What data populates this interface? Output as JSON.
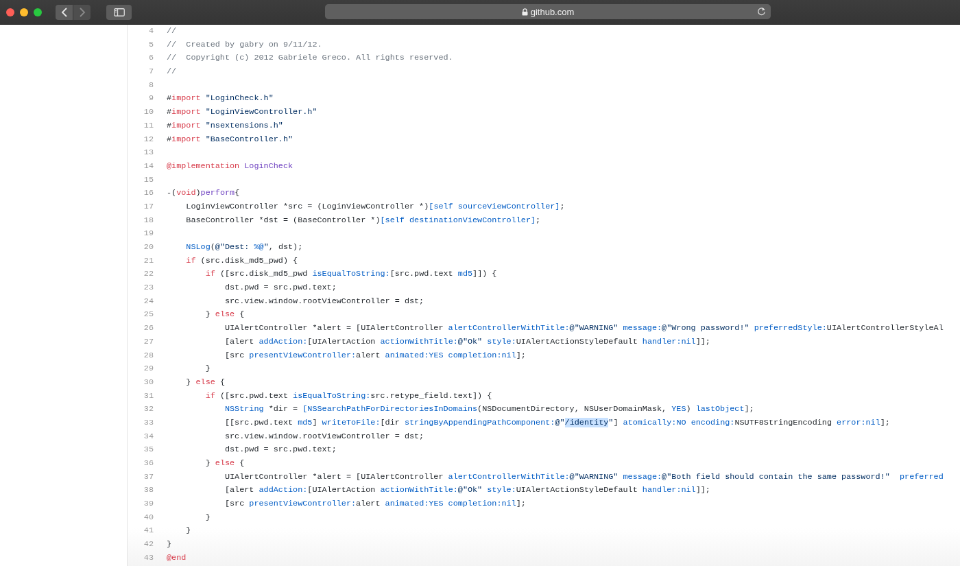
{
  "browser": {
    "window_controls": [
      {
        "color": "#fe5f57"
      },
      {
        "color": "#febc2e"
      },
      {
        "color": "#28c840"
      }
    ],
    "nav_buttons": [
      {
        "kind": "back",
        "disabled": false
      },
      {
        "kind": "forward",
        "disabled": true
      }
    ],
    "address": "github.com"
  },
  "code": {
    "lines": [
      {
        "number": "4",
        "tokens": [
          {
            "kind": "comment",
            "text": "//"
          }
        ]
      },
      {
        "number": "5",
        "tokens": [
          {
            "kind": "comment",
            "text": "//  Created by gabry on 9/11/12."
          }
        ]
      },
      {
        "number": "6",
        "tokens": [
          {
            "kind": "comment",
            "text": "//  Copyright (c) 2012 Gabriele Greco. All rights reserved."
          }
        ]
      },
      {
        "number": "7",
        "tokens": [
          {
            "kind": "comment",
            "text": "//"
          }
        ]
      },
      {
        "number": "8"
      },
      {
        "number": "9",
        "tokens": [
          {
            "kind": "plain",
            "text": "#"
          },
          {
            "kind": "keyword",
            "text": "import"
          },
          {
            "kind": "string",
            "text": " \"LoginCheck.h\""
          }
        ]
      },
      {
        "number": "10",
        "tokens": [
          {
            "kind": "plain",
            "text": "#"
          },
          {
            "kind": "keyword",
            "text": "import"
          },
          {
            "kind": "string",
            "text": " \"LoginViewController.h\""
          }
        ]
      },
      {
        "number": "11",
        "tokens": [
          {
            "kind": "plain",
            "text": "#"
          },
          {
            "kind": "keyword",
            "text": "import"
          },
          {
            "kind": "string",
            "text": " \"nsextensions.h\""
          }
        ]
      },
      {
        "number": "12",
        "tokens": [
          {
            "kind": "plain",
            "text": "#"
          },
          {
            "kind": "keyword",
            "text": "import"
          },
          {
            "kind": "string",
            "text": " \"BaseController.h\""
          }
        ]
      },
      {
        "number": "13"
      },
      {
        "number": "14",
        "tokens": [
          {
            "kind": "keyword",
            "text": "@implementation "
          },
          {
            "kind": "entity",
            "text": "LoginCheck"
          }
        ]
      },
      {
        "number": "15"
      },
      {
        "number": "16",
        "tokens": [
          {
            "kind": "plain",
            "text": "-("
          },
          {
            "kind": "keyword",
            "text": "void"
          },
          {
            "kind": "plain",
            "text": ")"
          },
          {
            "kind": "entity",
            "text": "perform"
          },
          {
            "kind": "plain",
            "text": "{"
          }
        ]
      },
      {
        "number": "17",
        "tokens": [
          {
            "kind": "plain",
            "text": "    LoginViewController *src = (LoginViewController *)"
          },
          {
            "kind": "call",
            "text": "[self sourceViewController]"
          },
          {
            "kind": "plain",
            "text": ";"
          }
        ]
      },
      {
        "number": "18",
        "tokens": [
          {
            "kind": "plain",
            "text": "    BaseController *dst = (BaseController *)"
          },
          {
            "kind": "call",
            "text": "[self destinationViewController]"
          },
          {
            "kind": "plain",
            "text": ";"
          }
        ]
      },
      {
        "number": "19"
      },
      {
        "number": "20",
        "tokens": [
          {
            "kind": "call",
            "text": "    NSLog"
          },
          {
            "kind": "plain",
            "text": "("
          },
          {
            "kind": "string",
            "text": "@\"Dest: "
          },
          {
            "kind": "call",
            "text": "%@"
          },
          {
            "kind": "string",
            "text": "\""
          },
          {
            "kind": "plain",
            "text": ", dst);"
          }
        ]
      },
      {
        "number": "21",
        "tokens": [
          {
            "kind": "keyword",
            "text": "    if"
          },
          {
            "kind": "plain",
            "text": " (src.disk_md5_pwd) {"
          }
        ]
      },
      {
        "number": "22",
        "tokens": [
          {
            "kind": "keyword",
            "text": "        if"
          },
          {
            "kind": "plain",
            "text": " ([src.disk_md5_pwd "
          },
          {
            "kind": "call",
            "text": "isEqualToString:"
          },
          {
            "kind": "plain",
            "text": "[src.pwd.text "
          },
          {
            "kind": "call",
            "text": "md5"
          },
          {
            "kind": "plain",
            "text": "]]) {"
          }
        ]
      },
      {
        "number": "23",
        "tokens": [
          {
            "kind": "plain",
            "text": "            dst.pwd = src.pwd.text;"
          }
        ]
      },
      {
        "number": "24",
        "tokens": [
          {
            "kind": "plain",
            "text": "            src.view.window.rootViewController = dst;"
          }
        ]
      },
      {
        "number": "25",
        "tokens": [
          {
            "kind": "plain",
            "text": "        } "
          },
          {
            "kind": "keyword",
            "text": "else"
          },
          {
            "kind": "plain",
            "text": " {"
          }
        ]
      },
      {
        "number": "26",
        "tokens": [
          {
            "kind": "plain",
            "text": "            UIAlertController *alert = [UIAlertController "
          },
          {
            "kind": "call",
            "text": "alertControllerWithTitle:"
          },
          {
            "kind": "string",
            "text": "@\"WARNING\" "
          },
          {
            "kind": "call",
            "text": "message:"
          },
          {
            "kind": "string",
            "text": "@\"Wrong password!\" "
          },
          {
            "kind": "call",
            "text": "preferredStyle:"
          },
          {
            "kind": "plain",
            "text": "UIAlertControllerStyleAl"
          }
        ]
      },
      {
        "number": "27",
        "tokens": [
          {
            "kind": "plain",
            "text": "            [alert "
          },
          {
            "kind": "call",
            "text": "addAction:"
          },
          {
            "kind": "plain",
            "text": "[UIAlertAction "
          },
          {
            "kind": "call",
            "text": "actionWithTitle:"
          },
          {
            "kind": "string",
            "text": "@\"Ok\" "
          },
          {
            "kind": "call",
            "text": "style:"
          },
          {
            "kind": "plain",
            "text": "UIAlertActionStyleDefault "
          },
          {
            "kind": "call",
            "text": "handler:nil"
          },
          {
            "kind": "plain",
            "text": "]];"
          }
        ]
      },
      {
        "number": "28",
        "tokens": [
          {
            "kind": "plain",
            "text": "            [src "
          },
          {
            "kind": "call",
            "text": "presentViewController:"
          },
          {
            "kind": "plain",
            "text": "alert "
          },
          {
            "kind": "call",
            "text": "animated:YES completion:nil"
          },
          {
            "kind": "plain",
            "text": "];"
          }
        ]
      },
      {
        "number": "29",
        "tokens": [
          {
            "kind": "plain",
            "text": "        }"
          }
        ]
      },
      {
        "number": "30",
        "tokens": [
          {
            "kind": "plain",
            "text": "    } "
          },
          {
            "kind": "keyword",
            "text": "else"
          },
          {
            "kind": "plain",
            "text": " {"
          }
        ]
      },
      {
        "number": "31",
        "tokens": [
          {
            "kind": "keyword",
            "text": "        if"
          },
          {
            "kind": "plain",
            "text": " ([src.pwd.text "
          },
          {
            "kind": "call",
            "text": "isEqualToString:"
          },
          {
            "kind": "plain",
            "text": "src.retype_field.text]) {"
          }
        ]
      },
      {
        "number": "32",
        "tokens": [
          {
            "kind": "call",
            "text": "            NSString"
          },
          {
            "kind": "plain",
            "text": " *dir = "
          },
          {
            "kind": "call",
            "text": "[NSSearchPathForDirectoriesInDomains"
          },
          {
            "kind": "plain",
            "text": "(NSDocumentDirectory, NSUserDomainMask, "
          },
          {
            "kind": "call",
            "text": "YES"
          },
          {
            "kind": "plain",
            "text": ") "
          },
          {
            "kind": "call",
            "text": "lastObject"
          },
          {
            "kind": "plain",
            "text": "];"
          }
        ]
      },
      {
        "number": "33",
        "tokens": [
          {
            "kind": "plain",
            "text": "            [[src.pwd.text "
          },
          {
            "kind": "call",
            "text": "md5"
          },
          {
            "kind": "plain",
            "text": "] "
          },
          {
            "kind": "call",
            "text": "writeToFile:"
          },
          {
            "kind": "plain",
            "text": "[dir "
          },
          {
            "kind": "call",
            "text": "stringByAppendingPathComponent:"
          },
          {
            "kind": "string",
            "text": "@\""
          },
          {
            "kind": "selection",
            "text": "/identity"
          },
          {
            "kind": "string",
            "text": "\""
          },
          {
            "kind": "plain",
            "text": "] "
          },
          {
            "kind": "call",
            "text": "atomically:NO encoding:"
          },
          {
            "kind": "plain",
            "text": "NSUTF8StringEncoding "
          },
          {
            "kind": "call",
            "text": "error:nil"
          },
          {
            "kind": "plain",
            "text": "];"
          }
        ]
      },
      {
        "number": "34",
        "tokens": [
          {
            "kind": "plain",
            "text": "            src.view.window.rootViewController = dst;"
          }
        ]
      },
      {
        "number": "35",
        "tokens": [
          {
            "kind": "plain",
            "text": "            dst.pwd = src.pwd.text;"
          }
        ]
      },
      {
        "number": "36",
        "tokens": [
          {
            "kind": "plain",
            "text": "        } "
          },
          {
            "kind": "keyword",
            "text": "else"
          },
          {
            "kind": "plain",
            "text": " {"
          }
        ]
      },
      {
        "number": "37",
        "tokens": [
          {
            "kind": "plain",
            "text": "            UIAlertController *alert = [UIAlertController "
          },
          {
            "kind": "call",
            "text": "alertControllerWithTitle:"
          },
          {
            "kind": "string",
            "text": "@\"WARNING\" "
          },
          {
            "kind": "call",
            "text": "message:"
          },
          {
            "kind": "string",
            "text": "@\"Both field should contain the same password!\"  "
          },
          {
            "kind": "call",
            "text": "preferred"
          }
        ]
      },
      {
        "number": "38",
        "tokens": [
          {
            "kind": "plain",
            "text": "            [alert "
          },
          {
            "kind": "call",
            "text": "addAction:"
          },
          {
            "kind": "plain",
            "text": "[UIAlertAction "
          },
          {
            "kind": "call",
            "text": "actionWithTitle:"
          },
          {
            "kind": "string",
            "text": "@\"Ok\" "
          },
          {
            "kind": "call",
            "text": "style:"
          },
          {
            "kind": "plain",
            "text": "UIAlertActionStyleDefault "
          },
          {
            "kind": "call",
            "text": "handler:nil"
          },
          {
            "kind": "plain",
            "text": "]];"
          }
        ]
      },
      {
        "number": "39",
        "tokens": [
          {
            "kind": "plain",
            "text": "            [src "
          },
          {
            "kind": "call",
            "text": "presentViewController:"
          },
          {
            "kind": "plain",
            "text": "alert "
          },
          {
            "kind": "call",
            "text": "animated:YES completion:nil"
          },
          {
            "kind": "plain",
            "text": "];"
          }
        ]
      },
      {
        "number": "40",
        "tokens": [
          {
            "kind": "plain",
            "text": "        }"
          }
        ]
      },
      {
        "number": "41",
        "tokens": [
          {
            "kind": "plain",
            "text": "    }"
          }
        ]
      },
      {
        "number": "42",
        "tokens": [
          {
            "kind": "plain",
            "text": "}"
          }
        ]
      },
      {
        "number": "43",
        "tokens": [
          {
            "kind": "keyword",
            "text": "@end"
          }
        ]
      }
    ]
  }
}
